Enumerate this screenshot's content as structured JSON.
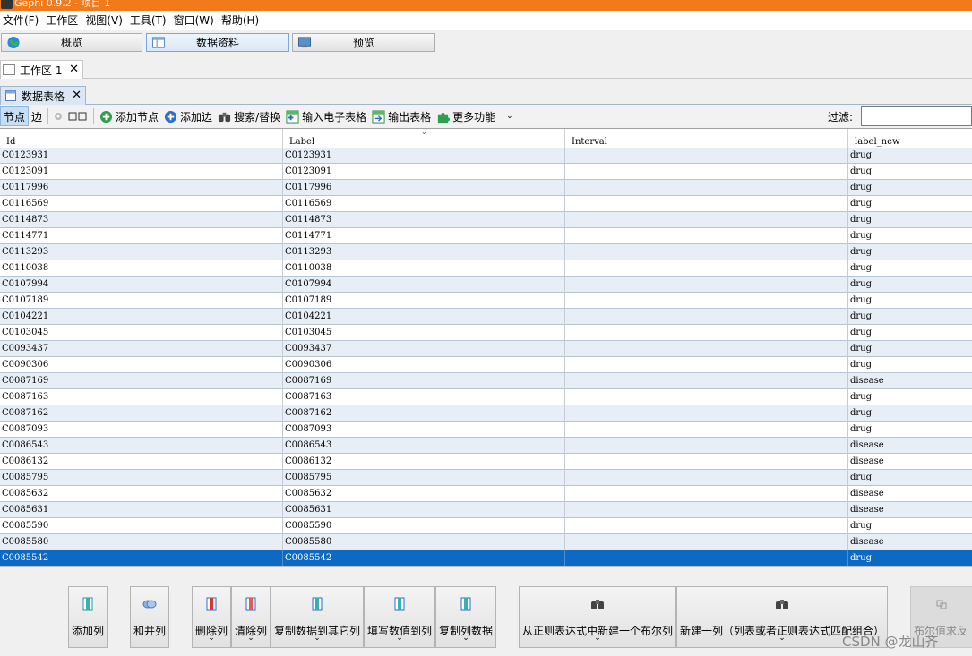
{
  "window": {
    "title": "Gephi 0.9.2 - 项目 1"
  },
  "menu": [
    "文件(F)",
    "工作区",
    "视图(V)",
    "工具(T)",
    "窗口(W)",
    "帮助(H)"
  ],
  "perspectives": {
    "overview": "概览",
    "data_lab": "数据资料",
    "preview": "预览"
  },
  "workspace_tab": "工作区 1",
  "datatable_tab": "数据表格",
  "close_glyph": "✕",
  "toolbar": {
    "nodes": "节点",
    "edges": "边",
    "add_node": "添加节点",
    "add_edge": "添加边",
    "search_replace": "搜索/替换",
    "import_spreadsheet": "输入电子表格",
    "export_table": "输出表格",
    "more": "更多功能",
    "filter_label": "过滤:"
  },
  "table": {
    "columns": [
      "Id",
      "Label",
      "Interval",
      "label_new"
    ],
    "rows": [
      {
        "id": "C0123931",
        "label": "C0123931",
        "interval": "",
        "label_new": "drug"
      },
      {
        "id": "C0123091",
        "label": "C0123091",
        "interval": "",
        "label_new": "drug"
      },
      {
        "id": "C0117996",
        "label": "C0117996",
        "interval": "",
        "label_new": "drug"
      },
      {
        "id": "C0116569",
        "label": "C0116569",
        "interval": "",
        "label_new": "drug"
      },
      {
        "id": "C0114873",
        "label": "C0114873",
        "interval": "",
        "label_new": "drug"
      },
      {
        "id": "C0114771",
        "label": "C0114771",
        "interval": "",
        "label_new": "drug"
      },
      {
        "id": "C0113293",
        "label": "C0113293",
        "interval": "",
        "label_new": "drug"
      },
      {
        "id": "C0110038",
        "label": "C0110038",
        "interval": "",
        "label_new": "drug"
      },
      {
        "id": "C0107994",
        "label": "C0107994",
        "interval": "",
        "label_new": "drug"
      },
      {
        "id": "C0107189",
        "label": "C0107189",
        "interval": "",
        "label_new": "drug"
      },
      {
        "id": "C0104221",
        "label": "C0104221",
        "interval": "",
        "label_new": "drug"
      },
      {
        "id": "C0103045",
        "label": "C0103045",
        "interval": "",
        "label_new": "drug"
      },
      {
        "id": "C0093437",
        "label": "C0093437",
        "interval": "",
        "label_new": "drug"
      },
      {
        "id": "C0090306",
        "label": "C0090306",
        "interval": "",
        "label_new": "drug"
      },
      {
        "id": "C0087169",
        "label": "C0087169",
        "interval": "",
        "label_new": "disease"
      },
      {
        "id": "C0087163",
        "label": "C0087163",
        "interval": "",
        "label_new": "drug"
      },
      {
        "id": "C0087162",
        "label": "C0087162",
        "interval": "",
        "label_new": "drug"
      },
      {
        "id": "C0087093",
        "label": "C0087093",
        "interval": "",
        "label_new": "drug"
      },
      {
        "id": "C0086543",
        "label": "C0086543",
        "interval": "",
        "label_new": "disease"
      },
      {
        "id": "C0086132",
        "label": "C0086132",
        "interval": "",
        "label_new": "disease"
      },
      {
        "id": "C0085795",
        "label": "C0085795",
        "interval": "",
        "label_new": "drug"
      },
      {
        "id": "C0085632",
        "label": "C0085632",
        "interval": "",
        "label_new": "disease"
      },
      {
        "id": "C0085631",
        "label": "C0085631",
        "interval": "",
        "label_new": "disease"
      },
      {
        "id": "C0085590",
        "label": "C0085590",
        "interval": "",
        "label_new": "drug"
      },
      {
        "id": "C0085580",
        "label": "C0085580",
        "interval": "",
        "label_new": "disease"
      },
      {
        "id": "C0085542",
        "label": "C0085542",
        "interval": "",
        "label_new": "drug"
      }
    ],
    "selected_id": "C0085542"
  },
  "bottom_buttons": {
    "add_column": "添加列",
    "merge_columns": "和并列",
    "delete_column": "删除列",
    "clear_column": "清除列",
    "copy_to_other": "复制数据到其它列",
    "fill_values": "填写数值到列",
    "duplicate_column": "复制列数据",
    "regex_boolean": "从正则表达式中新建一个布尔列",
    "regex_new_column": "新建一列（列表或者正则表达式匹配组合）",
    "boolean_negate": "布尔值求反"
  },
  "chevron_glyph": "⌄",
  "watermark": "CSDN @龙山齐",
  "colors": {
    "titlebar": "#f27a1a",
    "row_selected": "#0c6ac4",
    "row_alt": "#e7eef6"
  }
}
